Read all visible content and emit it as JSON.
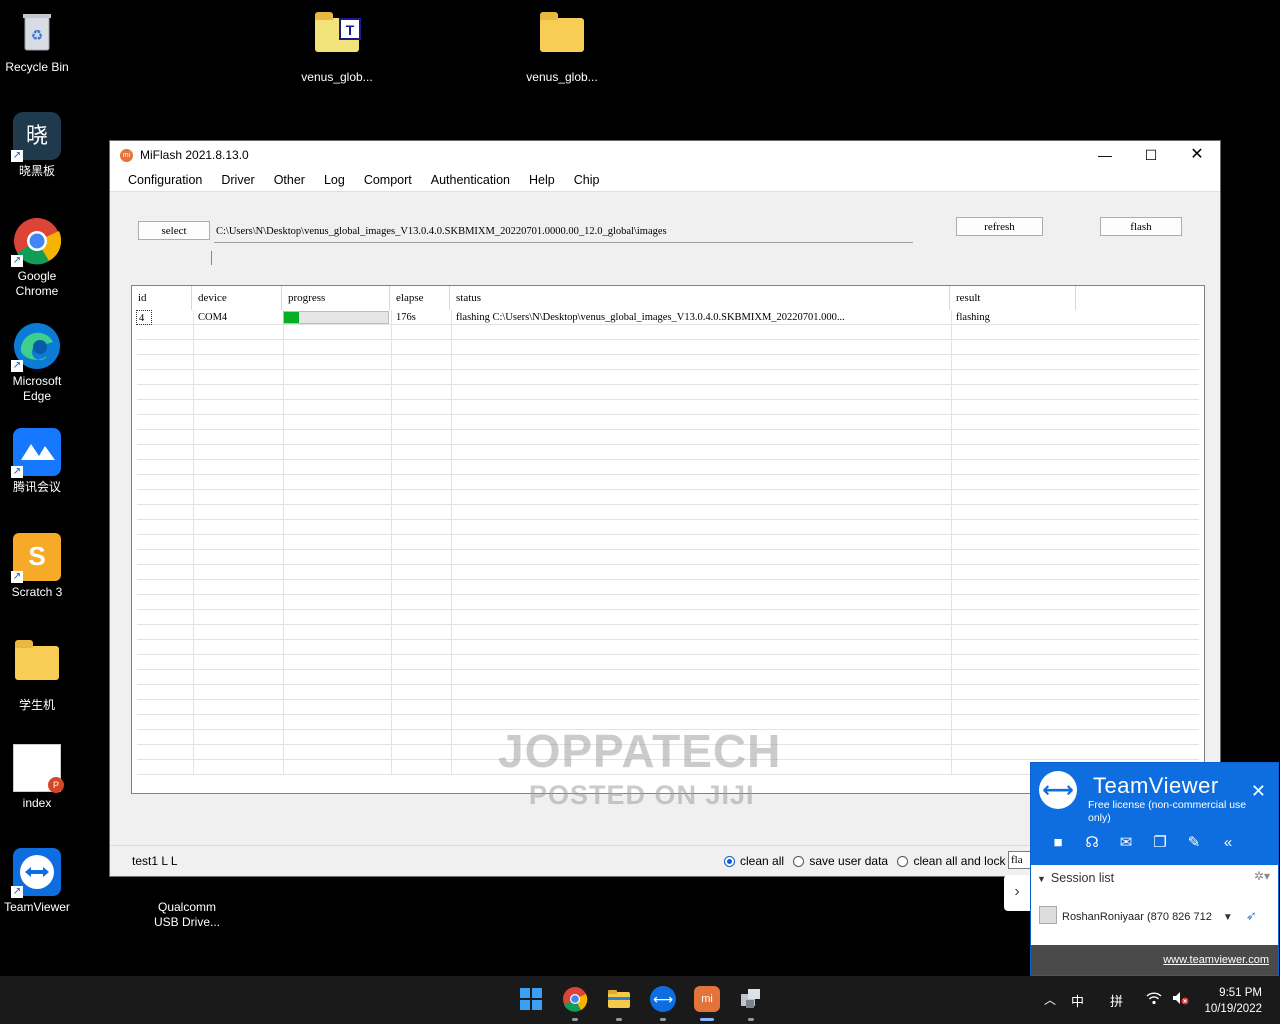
{
  "desktop": {
    "icons_left": [
      {
        "label": "Recycle Bin",
        "icon": "recycle-bin-icon"
      },
      {
        "label": "晓黑板",
        "icon": "xiaoheiban-icon"
      },
      {
        "label": "Google Chrome",
        "icon": "chrome-icon"
      },
      {
        "label": "Microsoft Edge",
        "icon": "edge-icon"
      },
      {
        "label": "腾讯会议",
        "icon": "tencent-meeting-icon"
      },
      {
        "label": "Scratch 3",
        "icon": "scratch-icon"
      },
      {
        "label": "学生机",
        "icon": "folder-icon"
      },
      {
        "label": "index",
        "icon": "powerpoint-file-icon"
      },
      {
        "label": "TeamViewer",
        "icon": "teamviewer-icon"
      }
    ],
    "icons_top": [
      {
        "label": "venus_glob...",
        "icon": "archive-folder-icon"
      },
      {
        "label": "venus_glob...",
        "icon": "folder-icon"
      }
    ],
    "icon_behind": {
      "label": "Qualcomm USB Drive..."
    }
  },
  "miflash": {
    "title": "MiFlash 2021.8.13.0",
    "menu": [
      "Configuration",
      "Driver",
      "Other",
      "Log",
      "Comport",
      "Authentication",
      "Help",
      "Chip"
    ],
    "select_label": "select",
    "path": "C:\\Users\\N\\Desktop\\venus_global_images_V13.0.4.0.SKBMIXM_20220701.0000.00_12.0_global\\images",
    "refresh_label": "refresh",
    "flash_label": "flash",
    "columns": [
      "id",
      "device",
      "progress",
      "elapse",
      "status",
      "result"
    ],
    "rows": [
      {
        "id": "4",
        "device": "COM4",
        "progress": 0.14,
        "elapse": "176s",
        "status": "flashing C:\\Users\\N\\Desktop\\venus_global_images_V13.0.4.0.SKBMIXM_20220701.000...",
        "result": "flashing"
      }
    ],
    "status_left": "test1  L  L",
    "options": [
      {
        "label": "clean all",
        "selected": true
      },
      {
        "label": "save user data",
        "selected": false
      },
      {
        "label": "clean all and lock",
        "selected": false
      }
    ],
    "extra_field": "fla"
  },
  "watermark": {
    "line1": "JOPPATECH",
    "line2": "POSTED ON JIJI"
  },
  "teamviewer": {
    "brand": "TeamViewer",
    "license": "Free license (non-commercial use only)",
    "session_list": "Session list",
    "user": "RoshanRoniyaar (870 826 712",
    "link": "www.teamviewer.com"
  },
  "taskbar": {
    "time": "9:51 PM",
    "date": "10/19/2022",
    "ime1": "中",
    "ime2": "拼"
  },
  "colors": {
    "accent": "#0a5fd8",
    "progress": "#06b025",
    "teamviewer_blue": "#0e6ee0"
  }
}
